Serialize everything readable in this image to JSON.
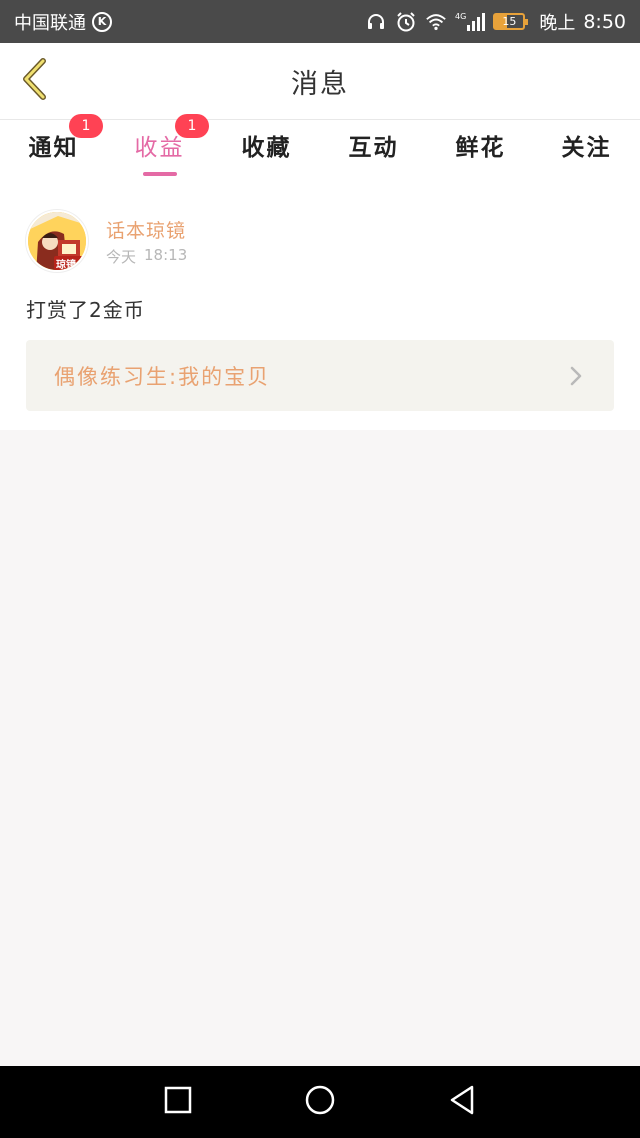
{
  "status_bar": {
    "carrier": "中国联通",
    "carrier_badge": "K",
    "network": "4G",
    "battery": "15",
    "time_prefix": "晚上",
    "time": "8:50",
    "icons": [
      "headset-icon",
      "alarm-icon",
      "wifi-icon",
      "signal-icon",
      "battery-icon"
    ]
  },
  "header": {
    "title": "消息",
    "back_icon": "chevron-left-icon"
  },
  "tabs": [
    {
      "label": "通知",
      "badge": "1",
      "active": false
    },
    {
      "label": "收益",
      "badge": "1",
      "active": true
    },
    {
      "label": "收藏",
      "badge": null,
      "active": false
    },
    {
      "label": "互动",
      "badge": null,
      "active": false
    },
    {
      "label": "鲜花",
      "badge": null,
      "active": false
    },
    {
      "label": "关注",
      "badge": null,
      "active": false
    }
  ],
  "message": {
    "sender": "话本琼镜",
    "date": "今天",
    "time": "18:13",
    "text": "打赏了2金币",
    "link_title": "偶像练习生:我的宝贝",
    "avatar_badge": "琼镜"
  },
  "colors": {
    "accent": "#e46aa5",
    "badge": "#ff4254",
    "name": "#e9a271",
    "card_bg": "#f4f3ee",
    "status_bar": "#4a4a4a"
  },
  "nav_bar": {
    "icons": [
      "recent-apps-icon",
      "home-icon",
      "back-icon"
    ]
  }
}
